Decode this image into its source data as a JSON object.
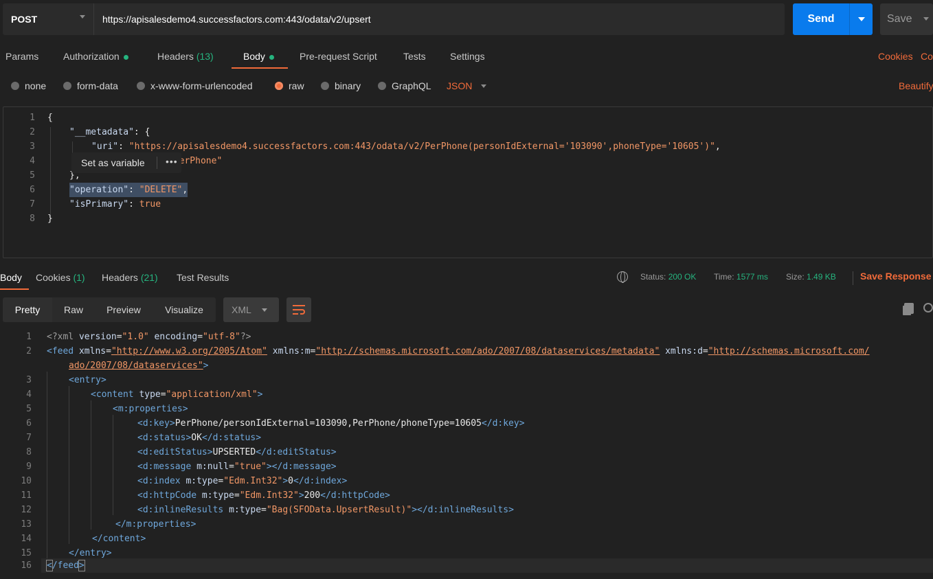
{
  "request": {
    "method": "POST",
    "url": "https://apisalesdemo4.successfactors.com:443/odata/v2/upsert",
    "send_label": "Send",
    "save_label": "Save"
  },
  "request_tabs": {
    "params": "Params",
    "authorization": "Authorization",
    "headers": "Headers",
    "headers_count": "(13)",
    "body": "Body",
    "prerequest": "Pre-request Script",
    "tests": "Tests",
    "settings": "Settings",
    "cookies": "Cookies",
    "code": "Co"
  },
  "body_types": {
    "none": "none",
    "form_data": "form-data",
    "urlencoded": "x-www-form-urlencoded",
    "raw": "raw",
    "binary": "binary",
    "graphql": "GraphQL",
    "format": "JSON",
    "beautify": "Beautify"
  },
  "request_body_lines": [
    {
      "n": "1",
      "text": "{"
    },
    {
      "n": "2",
      "key": "\"__metadata\"",
      "rest": ": {"
    },
    {
      "n": "3",
      "key": "\"uri\"",
      "colon": ": ",
      "value": "\"https://apisalesdemo4.successfactors.com:443/odata/v2/PerPhone(personIdExternal='103090',phoneType='10605')\"",
      "end": ","
    },
    {
      "n": "4",
      "value": ".PerPhone\""
    },
    {
      "n": "5",
      "text": "},"
    },
    {
      "n": "6",
      "key": "\"operation\"",
      "colon": ": ",
      "value": "\"DELETE\"",
      "end": ","
    },
    {
      "n": "7",
      "key": "\"isPrimary\"",
      "colon": ": ",
      "value": "true"
    },
    {
      "n": "8",
      "text": "}"
    }
  ],
  "tooltip": {
    "label": "Set as variable",
    "more": "•••"
  },
  "response_tabs": {
    "body": "Body",
    "cookies": "Cookies",
    "cookies_count": "(1)",
    "headers": "Headers",
    "headers_count": "(21)",
    "test_results": "Test Results"
  },
  "response_status": {
    "status_label": "Status:",
    "status_value": "200 OK",
    "time_label": "Time:",
    "time_value": "1577 ms",
    "size_label": "Size:",
    "size_value": "1.49 KB",
    "save_response": "Save Response"
  },
  "response_toolbar": {
    "pretty": "Pretty",
    "raw": "Raw",
    "preview": "Preview",
    "visualize": "Visualize",
    "format": "XML"
  },
  "response_lines": {
    "l1": {
      "n": "1",
      "a": "<?xml ",
      "b": "version",
      "c": "=",
      "d": "\"1.0\"",
      "e": " encoding",
      "f": "=",
      "g": "\"utf-8\"",
      "h": "?>"
    },
    "l2": {
      "n": "2",
      "t1": "<feed ",
      "a1": "xmlns",
      "eq1": "=",
      "u1": "\"http://www.w3.org/2005/Atom\"",
      "a2": " xmlns:m",
      "eq2": "=",
      "u2": "\"http://schemas.microsoft.com/ado/2007/08/dataservices/metadata\"",
      "a3": " xmlns:d",
      "eq3": "=",
      "u3": "\"http://schemas.microsoft.com/",
      "u3b": "ado/2007/08/dataservices\"",
      "close": ">"
    },
    "l3": {
      "n": "3",
      "t": "<entry>"
    },
    "l4": {
      "n": "4",
      "t1": "<content ",
      "a": "type",
      "eq": "=",
      "v": "\"application/xml\"",
      "close": ">"
    },
    "l5": {
      "n": "5",
      "t": "<m:properties>"
    },
    "l6": {
      "n": "6",
      "o": "<d:key>",
      "txt": "PerPhone/personIdExternal=103090,PerPhone/phoneType=10605",
      "c": "</d:key>"
    },
    "l7": {
      "n": "7",
      "o": "<d:status>",
      "txt": "OK",
      "c": "</d:status>"
    },
    "l8": {
      "n": "8",
      "o": "<d:editStatus>",
      "txt": "UPSERTED",
      "c": "</d:editStatus>"
    },
    "l9": {
      "n": "9",
      "o": "<d:message ",
      "a": "m:null",
      "eq": "=",
      "v": "\"true\"",
      "c": "></d:message>"
    },
    "l10": {
      "n": "10",
      "o": "<d:index ",
      "a": "m:type",
      "eq": "=",
      "v": "\"Edm.Int32\"",
      "gt": ">",
      "txt": "0",
      "c": "</d:index>"
    },
    "l11": {
      "n": "11",
      "o": "<d:httpCode ",
      "a": "m:type",
      "eq": "=",
      "v": "\"Edm.Int32\"",
      "gt": ">",
      "txt": "200",
      "c": "</d:httpCode>"
    },
    "l12": {
      "n": "12",
      "o": "<d:inlineResults ",
      "a": "m:type",
      "eq": "=",
      "v": "\"Bag(SFOData.UpsertResult)\"",
      "c": "></d:inlineResults>"
    },
    "l13": {
      "n": "13",
      "t": "</m:properties>"
    },
    "l14": {
      "n": "14",
      "t": "</content>"
    },
    "l15": {
      "n": "15",
      "t": "</entry>"
    },
    "l16": {
      "n": "16",
      "t1": "<",
      "t2": "/feed",
      "t3": ">"
    }
  },
  "colors": {
    "accent": "#f26b3a",
    "primary": "#097bed",
    "success": "#26b47f",
    "background": "#212121"
  }
}
